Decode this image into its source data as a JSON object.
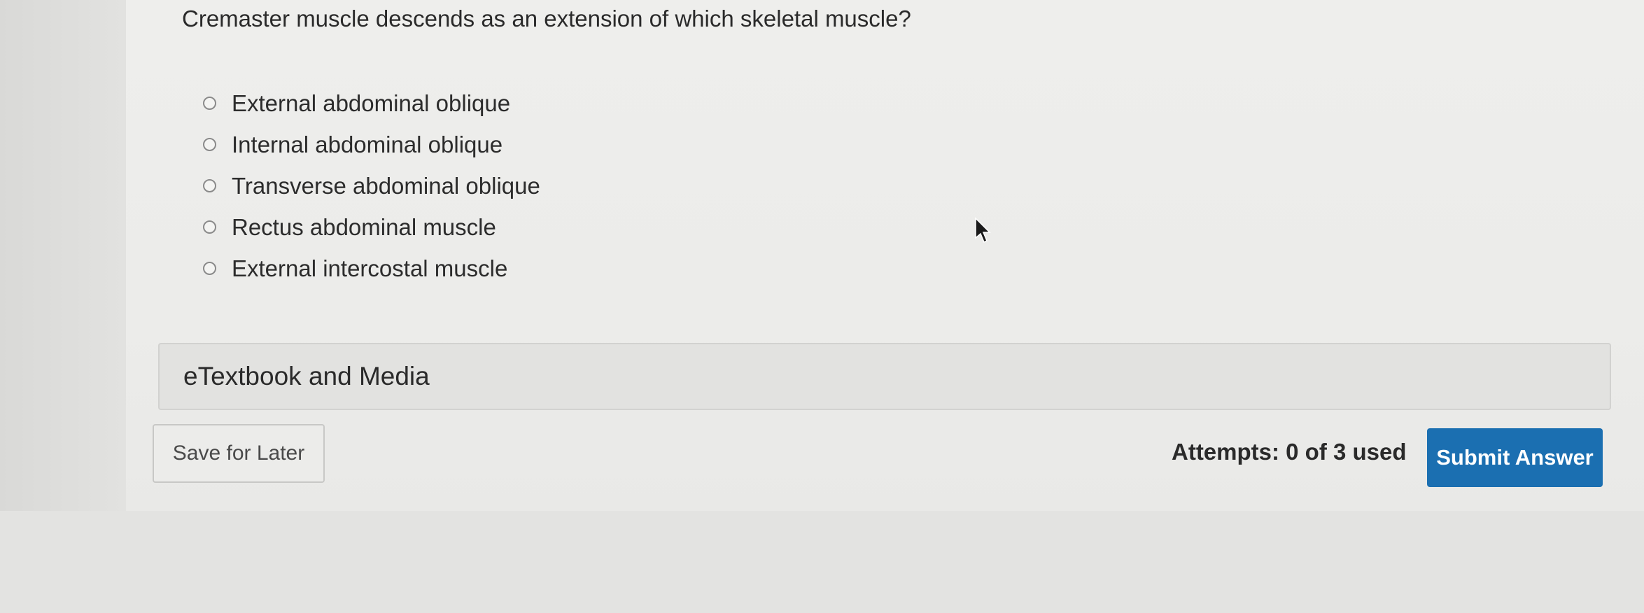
{
  "question": {
    "text": "Cremaster muscle descends as an extension of which skeletal muscle?"
  },
  "options": [
    {
      "label": "External abdominal oblique"
    },
    {
      "label": "Internal abdominal oblique"
    },
    {
      "label": "Transverse abdominal oblique"
    },
    {
      "label": "Rectus abdominal muscle"
    },
    {
      "label": "External intercostal muscle"
    }
  ],
  "resources": {
    "etextbook_label": "eTextbook and Media"
  },
  "footer": {
    "save_label": "Save for Later",
    "attempts_text": "Attempts: 0 of 3 used",
    "submit_label": "Submit Answer"
  },
  "colors": {
    "submit_bg": "#1b6fb1",
    "background": "#ececea"
  },
  "icons": {
    "pointer": "mouse-pointer-icon"
  }
}
